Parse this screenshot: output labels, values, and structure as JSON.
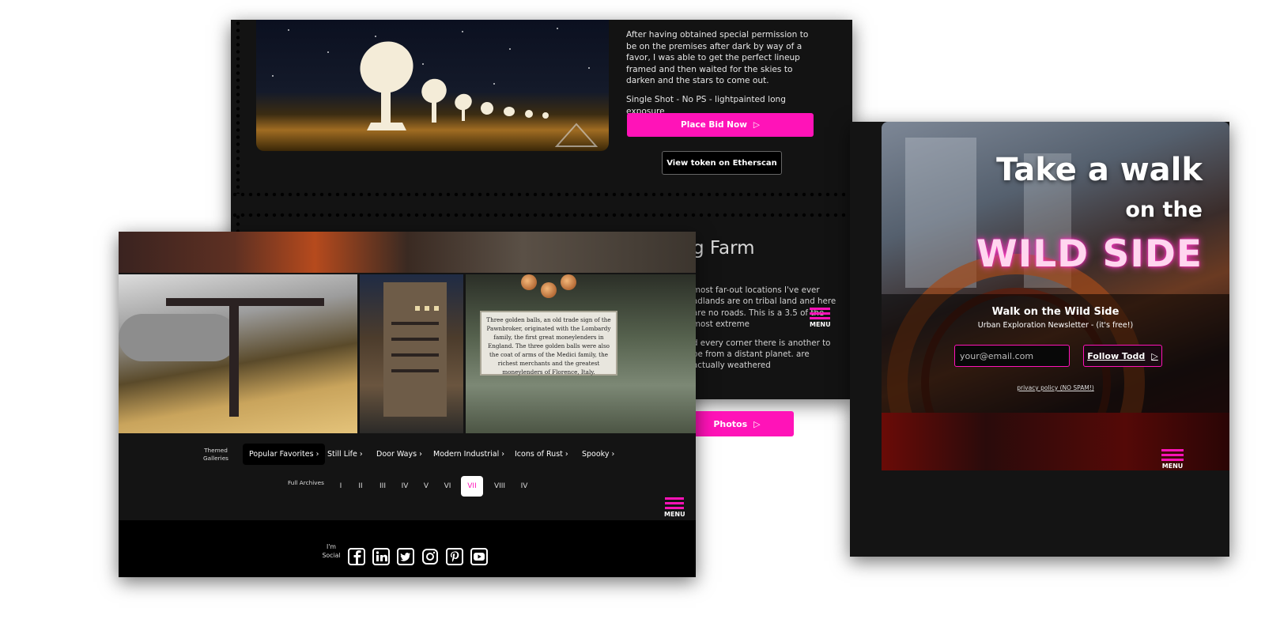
{
  "auction": {
    "paragraphs": [
      "After having obtained special permission to be on the premises after dark by way of a favor, I was able to get the perfect lineup framed and then waited for the skies to darken and the stars to come out.",
      "Single Shot - No PS - lightpainted long exposure"
    ],
    "bid_label": "Place Bid Now",
    "etherscan_label": "View token on Etherscan"
  },
  "farm": {
    "title_fragment": "g Farm",
    "paragraphs": [
      "most far-out locations I've ever adlands are on tribal land and here are no roads. This is a 3.5 of the most extreme",
      "d every corner there is another to be from a distant planet. are actually weathered"
    ],
    "photos_label": "Photos"
  },
  "menu_label": "MENU",
  "wildside": {
    "headline_1": "Take a walk",
    "headline_2": "on the",
    "headline_3": "WILD SIDE",
    "newsletter_title": "Walk on the Wild Side",
    "newsletter_subtitle": "Urban Exploration Newsletter - (it's free!)",
    "email_placeholder": "your@email.com",
    "follow_label": "Follow Todd",
    "privacy_label": "privacy policy (NO SPAM!)"
  },
  "galleries": {
    "sign_text": "Three golden balls, an old trade sign of the Pawnbroker, originated with the Lombardy family, the first great moneylenders in England. The three golden balls were also the coat of arms of the Medici family, the richest merchants and the greatest moneylenders of Florence, Italy.",
    "themed_label_1": "Themed",
    "themed_label_2": "Galleries",
    "items": [
      {
        "label": "Popular Favorites ›",
        "active": true
      },
      {
        "label": "Still Life ›",
        "active": false
      },
      {
        "label": "Door Ways ›",
        "active": false
      },
      {
        "label": "Modern Industrial ›",
        "active": false
      },
      {
        "label": "Icons of Rust ›",
        "active": false
      },
      {
        "label": "Spooky ›",
        "active": false
      }
    ],
    "archives_label": "Full Archives",
    "archives": [
      "I",
      "II",
      "III",
      "IV",
      "V",
      "VI",
      "VII",
      "VIII",
      "IV"
    ],
    "archive_active": "VII"
  },
  "social": {
    "label_1": "I'm",
    "label_2": "Social",
    "icons": [
      "facebook-icon",
      "linkedin-icon",
      "twitter-icon",
      "instagram-icon",
      "pinterest-icon",
      "youtube-icon"
    ]
  },
  "colors": {
    "accent": "#ff13b8",
    "background": "#131313"
  }
}
